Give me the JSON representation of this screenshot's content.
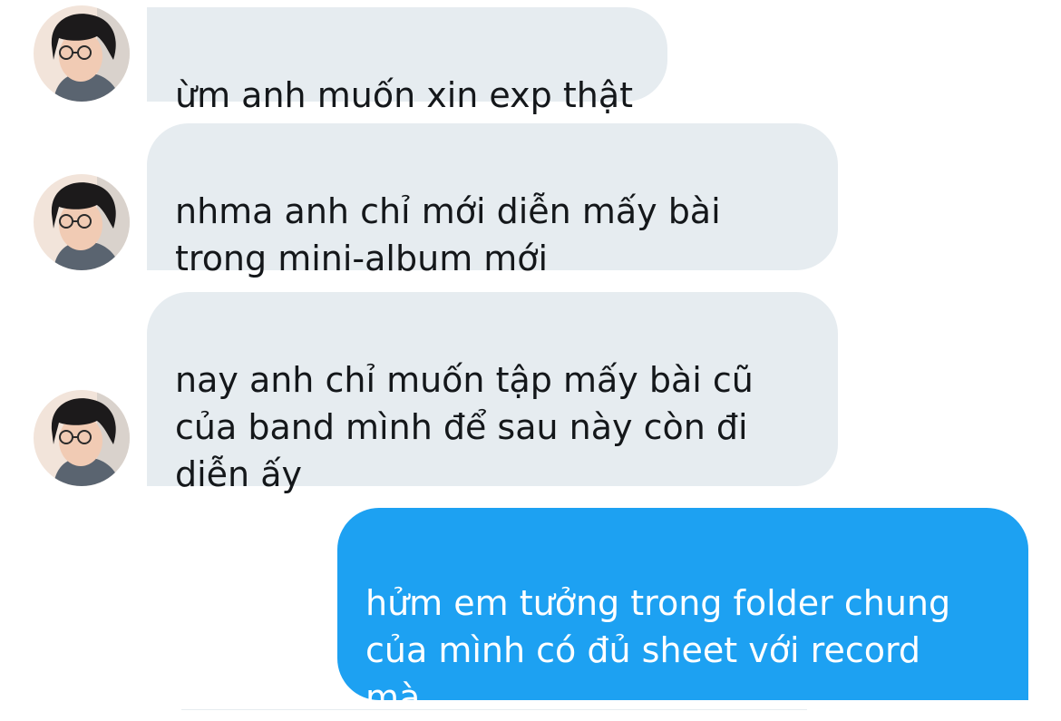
{
  "conversation": {
    "messages": [
      {
        "direction": "received",
        "text": "ừm anh muốn xin exp thật"
      },
      {
        "direction": "received",
        "text": "nhma anh chỉ mới diễn mấy bài\ntrong mini-album mới"
      },
      {
        "direction": "received",
        "text": "nay anh chỉ muốn tập mấy bài cũ\ncủa band mình để sau này còn đi\ndiễn ấy"
      },
      {
        "direction": "sent",
        "text": "hửm em tưởng trong folder chung\ncủa mình có đủ sheet với record\nmà"
      }
    ]
  },
  "colors": {
    "received_bubble": "#e6ecf0",
    "received_text": "#14171a",
    "sent_bubble": "#1da1f2",
    "sent_text": "#ffffff"
  }
}
